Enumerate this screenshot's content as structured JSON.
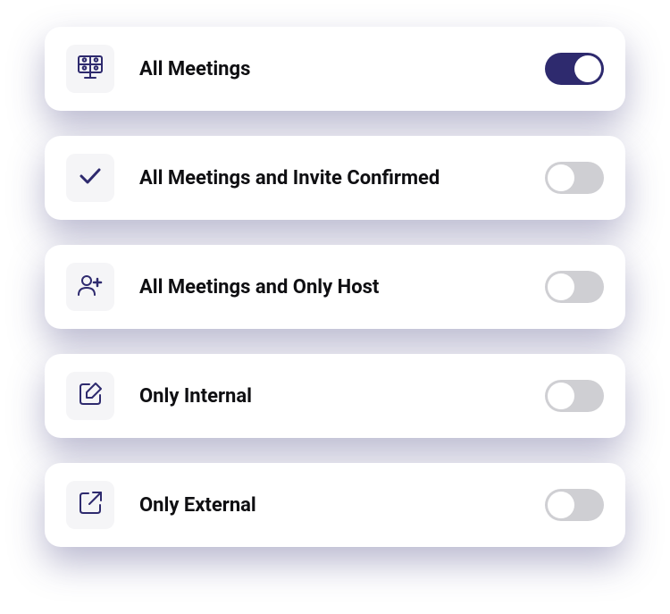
{
  "settings": [
    {
      "id": "all-meetings",
      "label": "All Meetings",
      "icon": "meetings",
      "enabled": true
    },
    {
      "id": "invite-confirmed",
      "label": "All Meetings and Invite Confirmed",
      "icon": "check",
      "enabled": false
    },
    {
      "id": "only-host",
      "label": "All Meetings and Only Host",
      "icon": "person-add",
      "enabled": false
    },
    {
      "id": "only-internal",
      "label": "Only Internal",
      "icon": "edit-square",
      "enabled": false
    },
    {
      "id": "only-external",
      "label": "Only External",
      "icon": "external-link",
      "enabled": false
    }
  ],
  "colors": {
    "accent": "#2e2a6e",
    "toggleOff": "#cfcfd3",
    "iconBoxBg": "#f5f5f7"
  }
}
